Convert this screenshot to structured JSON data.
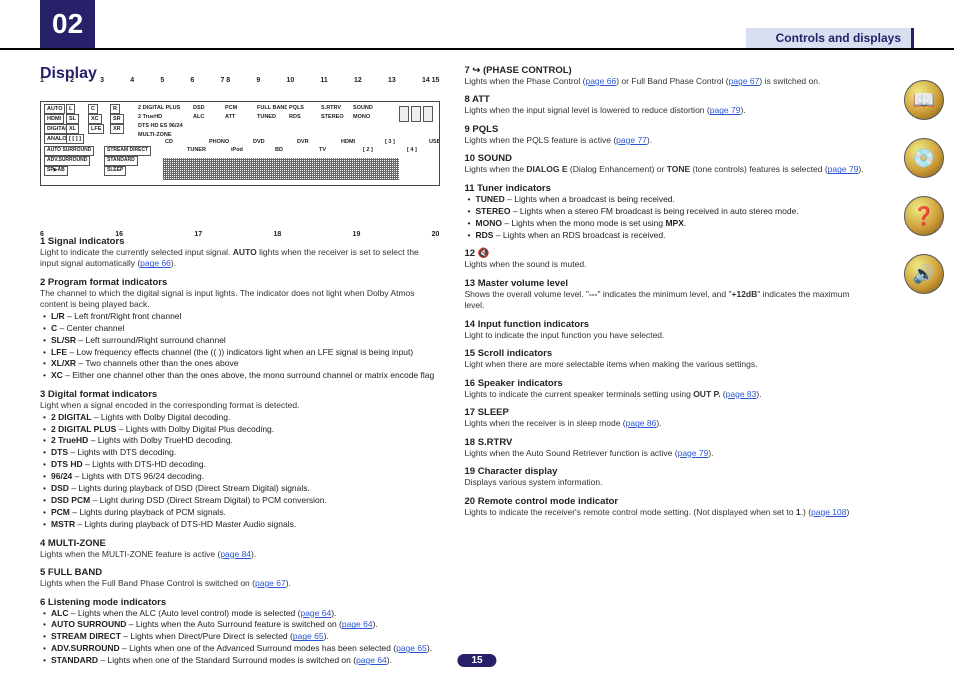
{
  "chapter": "02",
  "breadcrumb": "Controls and displays",
  "title": "Display",
  "page": "15",
  "callouts_top": [
    "1",
    "2",
    "3",
    "4",
    "5",
    "6",
    "7 8",
    "9",
    "10",
    "11",
    "12",
    "13",
    "14 15"
  ],
  "callouts_bot": [
    "6",
    "16",
    "17",
    "18",
    "19",
    "20"
  ],
  "diag": {
    "boxes": [
      "AUTO",
      "L",
      "C",
      "R",
      "HDMI",
      "SL",
      "XC",
      "SR",
      "DIGITAL",
      "XL",
      "LFE",
      "XR",
      "ANALOG",
      "[ [ ] ]"
    ],
    "fmts": [
      "2 DIGITAL PLUS",
      "2 TrueHD",
      "DTS HD ES 96/24",
      "MULTI-ZONE",
      "DSD",
      "PCM",
      "FULL BAND",
      "PQLS",
      "S.RTRV",
      "SOUND",
      "ALC",
      "ATT",
      "TUNED",
      "RDS",
      "STEREO",
      "MONO"
    ],
    "mid": [
      "AUTO SURROUND",
      "STREAM DIRECT",
      "ADV.SURROUND",
      "STANDARD",
      "SP▶AB",
      "SLEEP"
    ],
    "inputs": [
      "CD",
      "TUNER",
      "PHONO",
      "iPod",
      "DVD",
      "BD",
      "DVR",
      "TV",
      "HDMI",
      "[ 2 ]",
      "[ 3 ]",
      "[ 4 ]",
      "USB"
    ]
  },
  "left": [
    {
      "n": "1",
      "t": "Signal indicators",
      "b_pre": "Light to indicate the currently selected input signal. ",
      "b_bold": "AUTO",
      "b_post": " lights when the receiver is set to select the input signal automatically (",
      "pg": "page 66",
      "b_end": ")."
    },
    {
      "n": "2",
      "t": "Program format indicators",
      "b": "The channel to which the digital signal is input lights. The indicator does not light when Dolby Atmos content is being played back.",
      "subs": [
        {
          "b": "L/R",
          "r": " – Left front/Right front channel"
        },
        {
          "b": "C",
          "r": " – Center channel"
        },
        {
          "b": "SL/SR",
          "r": " – Left surround/Right surround channel"
        },
        {
          "b": "LFE",
          "r": " – Low frequency effects channel (the (( )) indicators light when an LFE signal is being input)"
        },
        {
          "b": "XL/XR",
          "r": " – Two channels other than the ones above"
        },
        {
          "b": "XC",
          "r": " – Either one channel other than the ones above, the mono surround channel or matrix encode flag"
        }
      ]
    },
    {
      "n": "3",
      "t": "Digital format indicators",
      "b": "Light when a signal encoded in the corresponding format is detected.",
      "subs": [
        {
          "b": "2 DIGITAL",
          "r": " – Lights with Dolby Digital decoding."
        },
        {
          "b": "2 DIGITAL PLUS",
          "r": " – Lights with Dolby Digital Plus decoding."
        },
        {
          "b": "2 TrueHD",
          "r": " – Lights with Dolby TrueHD decoding."
        },
        {
          "b": "DTS",
          "r": " – Lights with DTS decoding."
        },
        {
          "b": "DTS HD",
          "r": " – Lights with DTS-HD decoding."
        },
        {
          "b": "96/24",
          "r": " – Lights with DTS 96/24 decoding."
        },
        {
          "b": "DSD",
          "r": " – Lights during playback of DSD (Direct Stream Digital) signals."
        },
        {
          "b": "DSD PCM",
          "r": " – Light during DSD (Direct Stream Digital) to PCM conversion."
        },
        {
          "b": "PCM",
          "r": " – Lights during playback of PCM signals."
        },
        {
          "b": "MSTR",
          "r": " – Lights during playback of DTS-HD Master Audio signals."
        }
      ]
    },
    {
      "n": "4",
      "t": "MULTI-ZONE",
      "b_pre": "Lights when the MULTI-ZONE feature is active (",
      "pg": "page 84",
      "b_end": ")."
    },
    {
      "n": "5",
      "t": "FULL BAND",
      "b_pre": "Lights when the Full Band Phase Control is switched on (",
      "pg": "page 67",
      "b_end": ")."
    },
    {
      "n": "6",
      "t": "Listening mode indicators",
      "subs": [
        {
          "b": "ALC",
          "r": " – Lights when the ALC (Auto level control) mode is selected (",
          "pg": "page 64",
          "e": ")."
        },
        {
          "b": "AUTO SURROUND",
          "r": " – Lights when the Auto Surround feature is switched on (",
          "pg": "page 64",
          "e": ")."
        },
        {
          "b": "STREAM DIRECT",
          "r": " – Lights when Direct/Pure Direct is selected (",
          "pg": "page 65",
          "e": ")."
        },
        {
          "b": "ADV.SURROUND",
          "r": " – Lights when one of the Advanced Surround modes has been selected (",
          "pg": "page 65",
          "e": ")."
        },
        {
          "b": "STANDARD",
          "r": " – Lights when one of the Standard Surround modes is switched on (",
          "pg": "page 64",
          "e": ")."
        }
      ]
    }
  ],
  "right": [
    {
      "n": "7",
      "t": "(PHASE CONTROL)",
      "icon": "↪",
      "b_pre": "Lights when the Phase Control (",
      "pg": "page 66",
      "b_mid": ") or Full Band Phase Control (",
      "pg2": "page 67",
      "b_end": ") is switched on."
    },
    {
      "n": "8",
      "t": "ATT",
      "b_pre": "Lights when the input signal level is lowered to reduce distortion (",
      "pg": "page 79",
      "b_end": ")."
    },
    {
      "n": "9",
      "t": "PQLS",
      "b_pre": "Lights when the PQLS feature is active (",
      "pg": "page 77",
      "b_end": ")."
    },
    {
      "n": "10",
      "t": "SOUND",
      "b_pre": "Lights when the ",
      "b_bold": "DIALOG E",
      "b_post": " (Dialog Enhancement) or ",
      "b_bold2": "TONE",
      "b_post2": " (tone controls) features is selected (",
      "pg": "page 79",
      "b_end": ")."
    },
    {
      "n": "11",
      "t": "Tuner indicators",
      "subs": [
        {
          "b": "TUNED",
          "r": " – Lights when a broadcast is being received."
        },
        {
          "b": "STEREO",
          "r": " – Lights when a stereo FM broadcast is being received in auto stereo mode."
        },
        {
          "b": "MONO",
          "r": " – Lights when the mono mode is set using ",
          "bb": "MPX",
          "e": "."
        },
        {
          "b": "RDS",
          "r": " – Lights when an RDS broadcast is received."
        }
      ]
    },
    {
      "n": "12",
      "t": "",
      "icon": "🔇",
      "b": "Lights when the sound is muted."
    },
    {
      "n": "13",
      "t": "Master volume level",
      "b_pre": "Shows the overall volume level.\n\"",
      "b_bold": "---",
      "b_post": "\" indicates the minimum level, and \"",
      "b_bold2": "+12dB",
      "b_post2": "\" indicates the maximum level."
    },
    {
      "n": "14",
      "t": "Input function indicators",
      "b": "Light to indicate the input function you have selected."
    },
    {
      "n": "15",
      "t": "Scroll indicators",
      "b": "Light when there are more selectable items when making the various settings."
    },
    {
      "n": "16",
      "t": "Speaker indicators",
      "b_pre": "Lights to indicate the current speaker terminals setting using ",
      "b_bold": "OUT P.",
      "b_post": " (",
      "pg": "page 83",
      "b_end": ")."
    },
    {
      "n": "17",
      "t": "SLEEP",
      "b_pre": "Lights when the receiver is in sleep mode (",
      "pg": "page 86",
      "b_end": ")."
    },
    {
      "n": "18",
      "t": "S.RTRV",
      "b_pre": "Lights when the Auto Sound Retriever function is active (",
      "pg": "page 79",
      "b_end": ")."
    },
    {
      "n": "19",
      "t": "Character display",
      "b": "Displays various system information."
    },
    {
      "n": "20",
      "t": "Remote control mode indicator",
      "b_pre": "Lights to indicate the receiver's remote control mode setting. (Not displayed when set to ",
      "b_bold": "1",
      "b_post": ".) (",
      "pg": "page 108",
      "b_end": ")"
    }
  ],
  "icons": [
    "📖",
    "💿",
    "❓",
    "🔊"
  ]
}
